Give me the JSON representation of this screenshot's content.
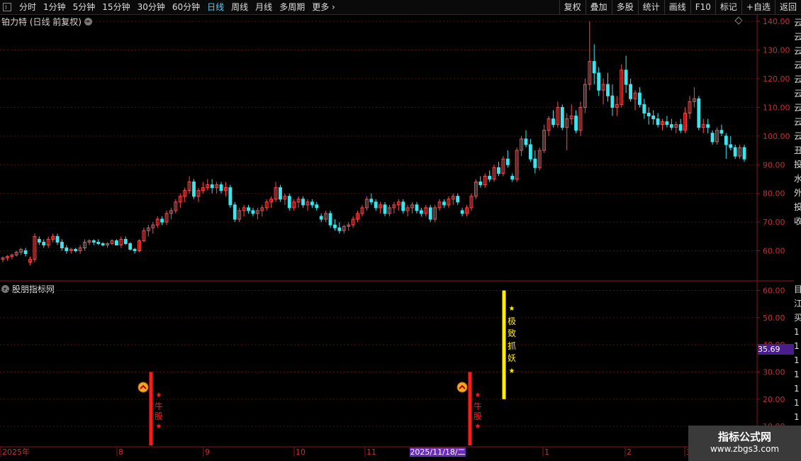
{
  "toolbar": {
    "periods": [
      "分时",
      "1分钟",
      "5分钟",
      "15分钟",
      "30分钟",
      "60分钟",
      "日线",
      "周线",
      "月线",
      "多周期",
      "更多"
    ],
    "active_period": "日线",
    "buttons": [
      "复权",
      "叠加",
      "多股",
      "统计",
      "画线",
      "F10",
      "标记",
      "+自选",
      "返回"
    ]
  },
  "main_chart": {
    "title": "铂力特 (日线 前复权)",
    "y_ticks": [
      "140.00",
      "130.00",
      "120.00",
      "110.00",
      "100.00",
      "90.00",
      "80.00",
      "70.00",
      "60.00"
    ],
    "ylim": [
      50,
      142
    ],
    "colors": {
      "up": "#ff4a4a",
      "down": "#3ae6ee",
      "grid": "#5a0f0f",
      "axis": "#8a1515"
    }
  },
  "indicator": {
    "title": "股朋指标网",
    "y_ticks": [
      "60.00",
      "50.00",
      "40.00",
      "30.00",
      "20.00",
      "10.00"
    ],
    "ylim": [
      3,
      63
    ],
    "current_value": "35.69",
    "signals": [
      {
        "name": "bull-stock-signal",
        "color": "#ff1a1a",
        "from": 0,
        "to": 30,
        "text": [
          "★",
          "牛",
          "股",
          "★"
        ]
      },
      {
        "name": "bull-stock-signal-2",
        "color": "#ff1a1a",
        "from": 0,
        "to": 30,
        "text": [
          "★",
          "牛",
          "股",
          "★"
        ]
      },
      {
        "name": "extreme-demon-signal",
        "color": "#ffee00",
        "from": 20,
        "to": 60,
        "text": [
          "★",
          "极",
          "致",
          "抓",
          "妖",
          "★"
        ]
      }
    ]
  },
  "x_axis": {
    "labels": [
      "2025年",
      "8",
      "9",
      "10",
      "11",
      "1",
      "2",
      "3"
    ],
    "highlight_date": "2025/11/18/二"
  },
  "side_strip_chars": [
    "云",
    "云",
    "云",
    "云",
    "云",
    "云",
    "云",
    "云",
    "云",
    "丑",
    "投",
    "水",
    "外",
    "投",
    "收"
  ],
  "side_strip2_chars": [
    "目",
    "江",
    "买",
    "1",
    "1",
    "1",
    "1",
    "1",
    "1",
    "1",
    "1"
  ],
  "watermark": {
    "title": "指标公式网",
    "url": "www.zbgs3.com"
  },
  "chart_data": {
    "type": "candlestick",
    "title": "铂力特 (日线 前复权)",
    "ylim": [
      50,
      142
    ],
    "candles": [
      [
        57,
        58,
        56,
        57.5
      ],
      [
        57.5,
        58.5,
        56.5,
        58
      ],
      [
        58,
        59,
        57,
        58.5
      ],
      [
        58.5,
        60,
        58,
        59.5
      ],
      [
        59.5,
        61,
        58.5,
        60.5
      ],
      [
        60,
        61,
        58,
        59
      ],
      [
        56,
        58,
        55,
        57
      ],
      [
        57,
        66,
        56,
        65
      ],
      [
        64,
        65,
        62,
        63
      ],
      [
        63,
        64,
        61,
        62
      ],
      [
        62,
        65,
        61,
        64
      ],
      [
        64,
        66,
        63,
        65
      ],
      [
        65,
        66,
        62,
        63
      ],
      [
        63,
        64,
        60,
        61
      ],
      [
        61,
        62,
        59,
        60
      ],
      [
        60,
        61,
        59,
        60.5
      ],
      [
        60.5,
        61,
        59.5,
        60
      ],
      [
        60,
        62,
        59,
        61
      ],
      [
        61,
        64,
        60,
        63
      ],
      [
        63,
        64,
        62,
        63.5
      ],
      [
        63.5,
        64,
        62,
        63
      ],
      [
        63,
        64,
        62,
        62.5
      ],
      [
        62.5,
        63,
        61.5,
        62
      ],
      [
        62,
        63,
        61,
        62.5
      ],
      [
        62.5,
        64,
        62,
        63.5
      ],
      [
        63.5,
        64,
        62,
        62
      ],
      [
        62,
        65,
        61,
        64
      ],
      [
        64,
        65,
        62,
        62.5
      ],
      [
        62.5,
        63,
        60,
        60.5
      ],
      [
        60.5,
        61,
        59,
        60
      ],
      [
        60,
        64,
        59.5,
        63.5
      ],
      [
        63.5,
        68,
        63,
        67
      ],
      [
        67,
        69,
        65,
        68
      ],
      [
        68,
        70,
        66,
        69
      ],
      [
        69,
        72,
        68,
        71
      ],
      [
        71,
        72,
        69,
        70
      ],
      [
        70,
        74,
        69,
        73
      ],
      [
        73,
        75,
        71,
        74
      ],
      [
        74,
        78,
        73,
        77
      ],
      [
        77,
        80,
        75,
        79
      ],
      [
        79,
        82,
        77,
        81
      ],
      [
        81,
        86,
        80,
        84
      ],
      [
        84,
        85,
        78,
        79
      ],
      [
        79,
        82,
        77,
        81
      ],
      [
        81,
        84,
        80,
        82
      ],
      [
        82,
        85,
        81,
        83
      ],
      [
        83,
        85,
        80,
        82
      ],
      [
        82,
        84,
        80,
        83
      ],
      [
        83,
        84,
        80,
        81
      ],
      [
        81,
        84,
        79,
        82
      ],
      [
        82,
        83,
        75,
        76
      ],
      [
        76,
        77,
        70,
        71
      ],
      [
        71,
        75,
        70,
        74
      ],
      [
        74,
        76,
        72,
        75
      ],
      [
        75,
        76,
        73,
        74
      ],
      [
        74,
        75,
        72,
        73
      ],
      [
        73,
        75,
        71,
        74
      ],
      [
        74,
        76,
        72,
        75
      ],
      [
        75,
        78,
        74,
        77
      ],
      [
        77,
        79,
        75,
        78
      ],
      [
        78,
        84,
        77,
        82
      ],
      [
        82,
        83,
        77,
        78
      ],
      [
        78,
        80,
        76,
        79
      ],
      [
        79,
        80,
        74,
        75
      ],
      [
        75,
        78,
        74,
        77
      ],
      [
        77,
        79,
        75,
        78
      ],
      [
        78,
        79,
        75,
        76
      ],
      [
        76,
        78,
        74,
        77
      ],
      [
        77,
        78,
        75,
        76
      ],
      [
        76,
        77,
        74,
        75
      ],
      [
        72,
        73,
        70,
        71
      ],
      [
        71,
        74,
        70,
        73
      ],
      [
        73,
        74,
        68,
        69
      ],
      [
        69,
        71,
        67,
        68
      ],
      [
        68,
        70,
        66,
        67
      ],
      [
        67,
        69,
        66,
        68.5
      ],
      [
        68.5,
        70,
        67,
        69
      ],
      [
        69,
        72,
        68,
        71
      ],
      [
        71,
        74,
        70,
        73
      ],
      [
        73,
        76,
        72,
        75
      ],
      [
        75,
        79,
        74,
        78
      ],
      [
        78,
        80,
        76,
        77
      ],
      [
        77,
        78,
        74,
        75
      ],
      [
        75,
        77,
        73,
        76
      ],
      [
        76,
        77,
        72,
        73
      ],
      [
        73,
        76,
        72,
        75
      ],
      [
        75,
        77,
        73,
        76
      ],
      [
        76,
        78,
        74,
        77
      ],
      [
        77,
        78,
        73,
        74
      ],
      [
        74,
        76,
        72,
        75
      ],
      [
        75,
        77,
        73,
        76
      ],
      [
        76,
        77,
        73,
        74
      ],
      [
        74,
        75,
        72,
        73
      ],
      [
        73,
        76,
        72,
        75
      ],
      [
        75,
        76,
        70,
        71
      ],
      [
        71,
        76,
        70,
        75
      ],
      [
        75,
        78,
        74,
        77
      ],
      [
        77,
        78,
        75,
        76
      ],
      [
        76,
        79,
        75,
        78
      ],
      [
        78,
        80,
        76,
        79
      ],
      [
        79,
        80,
        76,
        77
      ],
      [
        74,
        75,
        72,
        73
      ],
      [
        73,
        76,
        72,
        75
      ],
      [
        75,
        80,
        74,
        79
      ],
      [
        79,
        85,
        78,
        84
      ],
      [
        84,
        86,
        82,
        83
      ],
      [
        83,
        87,
        82,
        86
      ],
      [
        86,
        88,
        84,
        85
      ],
      [
        85,
        90,
        84,
        89
      ],
      [
        89,
        91,
        86,
        87
      ],
      [
        87,
        93,
        86,
        92
      ],
      [
        92,
        95,
        89,
        90
      ],
      [
        86,
        87,
        84,
        85
      ],
      [
        85,
        96,
        84,
        95
      ],
      [
        95,
        100,
        93,
        99
      ],
      [
        99,
        102,
        96,
        97
      ],
      [
        97,
        99,
        91,
        92
      ],
      [
        92,
        95,
        87,
        89
      ],
      [
        89,
        96,
        88,
        95
      ],
      [
        95,
        104,
        94,
        102
      ],
      [
        102,
        107,
        100,
        106
      ],
      [
        106,
        109,
        103,
        104
      ],
      [
        104,
        112,
        103,
        110
      ],
      [
        110,
        111,
        102,
        103
      ],
      [
        103,
        108,
        95,
        106
      ],
      [
        106,
        111,
        104,
        107
      ],
      [
        107,
        109,
        101,
        102
      ],
      [
        102,
        112,
        100,
        110
      ],
      [
        110,
        120,
        108,
        118
      ],
      [
        118,
        140,
        116,
        126
      ],
      [
        126,
        132,
        118,
        122
      ],
      [
        122,
        124,
        114,
        116
      ],
      [
        116,
        120,
        111,
        118
      ],
      [
        118,
        122,
        112,
        114
      ],
      [
        114,
        118,
        107,
        110
      ],
      [
        110,
        114,
        107,
        111
      ],
      [
        111,
        125,
        110,
        123
      ],
      [
        123,
        128,
        115,
        118
      ],
      [
        118,
        120,
        112,
        113
      ],
      [
        113,
        116,
        109,
        115
      ],
      [
        115,
        117,
        110,
        111
      ],
      [
        111,
        113,
        106,
        108
      ],
      [
        108,
        110,
        104,
        107
      ],
      [
        107,
        109,
        104,
        106
      ],
      [
        106,
        108,
        103,
        104
      ],
      [
        104,
        106,
        102,
        105
      ],
      [
        105,
        107,
        103,
        104
      ],
      [
        104,
        106,
        102,
        103
      ],
      [
        103,
        105,
        101,
        104
      ],
      [
        104,
        106,
        101,
        102
      ],
      [
        102,
        110,
        101,
        108
      ],
      [
        108,
        114,
        106,
        112
      ],
      [
        112,
        117,
        110,
        113
      ],
      [
        113,
        114,
        102,
        103
      ],
      [
        103,
        106,
        101,
        104
      ],
      [
        104,
        106,
        101,
        103
      ],
      [
        101,
        102,
        97,
        98
      ],
      [
        98,
        103,
        97,
        102
      ],
      [
        102,
        104,
        100,
        101
      ],
      [
        100,
        101,
        92,
        97
      ],
      [
        97,
        100,
        95,
        96
      ],
      [
        96,
        97,
        92,
        93
      ],
      [
        93,
        97,
        92,
        96
      ],
      [
        96,
        97,
        91,
        92
      ]
    ]
  }
}
